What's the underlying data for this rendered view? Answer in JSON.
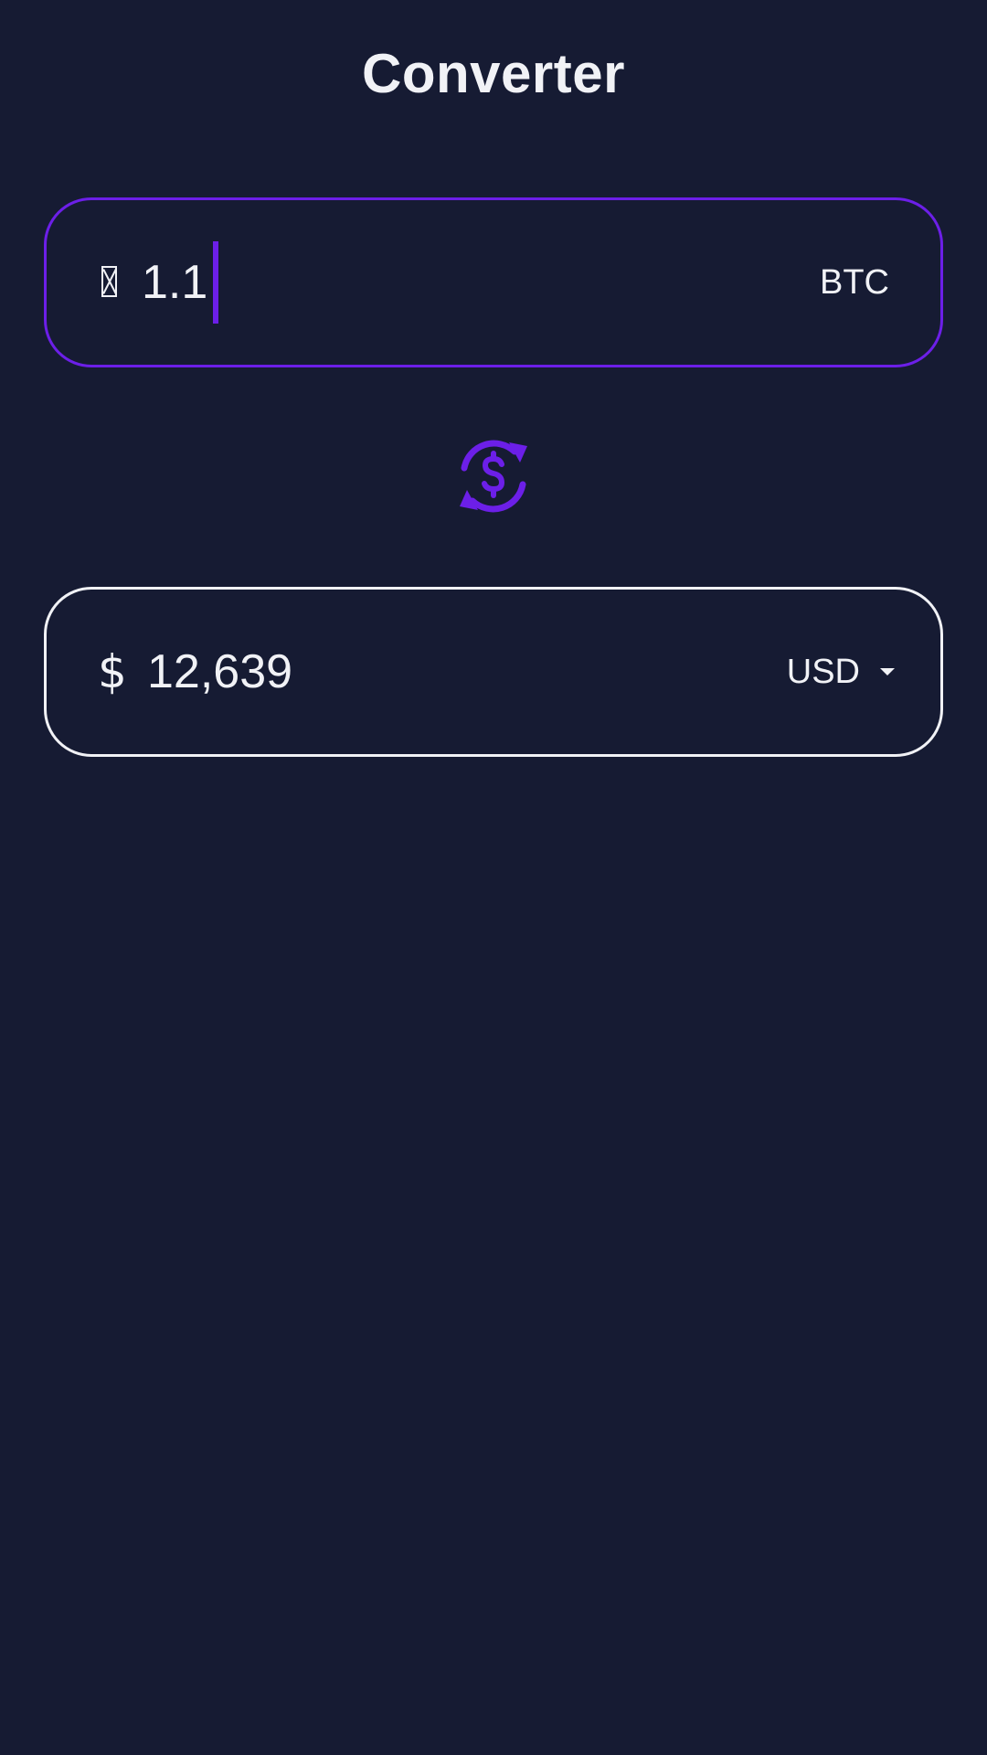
{
  "header": {
    "title": "Converter"
  },
  "from": {
    "symbol_icon": "bitcoin-symbol-missing-glyph",
    "value": "1.1",
    "currency": "BTC"
  },
  "swap": {
    "icon": "currency-exchange-icon"
  },
  "to": {
    "symbol": "$",
    "value": "12,639",
    "currency": "USD"
  },
  "colors": {
    "background": "#161b33",
    "accent": "#6c1fe8",
    "text": "#f1f2f6"
  }
}
